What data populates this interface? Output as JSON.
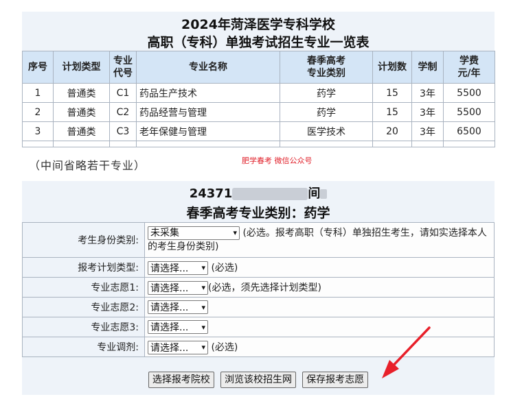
{
  "top": {
    "title_line1": "2024年菏泽医学专科学校",
    "title_line2": "高职（专科）单独考试招生专业一览表",
    "columns": [
      "序号",
      "计划类型",
      "专业代号",
      "专业名称",
      "春季高考专业类别",
      "计划数",
      "学制",
      "学费元/年"
    ],
    "columns_display": [
      [
        "序号"
      ],
      [
        "计划类型"
      ],
      [
        "专业",
        "代号"
      ],
      [
        "专业名称"
      ],
      [
        "春季高考",
        "专业类别"
      ],
      [
        "计划数"
      ],
      [
        "学制"
      ],
      [
        "学费",
        "元/年"
      ]
    ],
    "rows": [
      [
        "1",
        "普通类",
        "C1",
        "药品生产技术",
        "药学",
        "15",
        "3年",
        "5500"
      ],
      [
        "2",
        "普通类",
        "C2",
        "药品经营与管理",
        "药学",
        "15",
        "3年",
        "5500"
      ],
      [
        "3",
        "普通类",
        "C3",
        "老年保健与管理",
        "医学技术",
        "20",
        "3年",
        "6500"
      ]
    ]
  },
  "omit_note": "（中间省略若干专业）",
  "watermark": "肥学春考 微信公众号",
  "bottom": {
    "code_prefix": "24371",
    "code_suffix": "间",
    "category_line": "春季高考专业类别：药学",
    "form": {
      "identity_label": "考生身份类别:",
      "identity_value": "未采集",
      "identity_hint": "(必选。报考高职（专科）单独招生考生，请如实选择本人的考生身份类别)",
      "plan_type_label": "报考计划类型:",
      "plan_type_value": "请选择...",
      "plan_type_hint": "(必选)",
      "choice1_label": "专业志愿1:",
      "choice1_value": "请选择...",
      "choice1_hint": "(必选，须先选择计划类型)",
      "choice2_label": "专业志愿2:",
      "choice2_value": "请选择...",
      "choice3_label": "专业志愿3:",
      "choice3_value": "请选择...",
      "adjust_label": "专业调剂:",
      "adjust_value": "请选择...",
      "adjust_hint": "(必选)"
    },
    "buttons": {
      "choose_school": "选择报考院校",
      "browse_site": "浏览该校招生网",
      "save": "保存报考志愿"
    }
  },
  "colors": {
    "panel_bg": "#eef3f9",
    "header_bg": "#d4e5f6",
    "arrow": "#e8202a",
    "watermark": "#e0202a"
  }
}
